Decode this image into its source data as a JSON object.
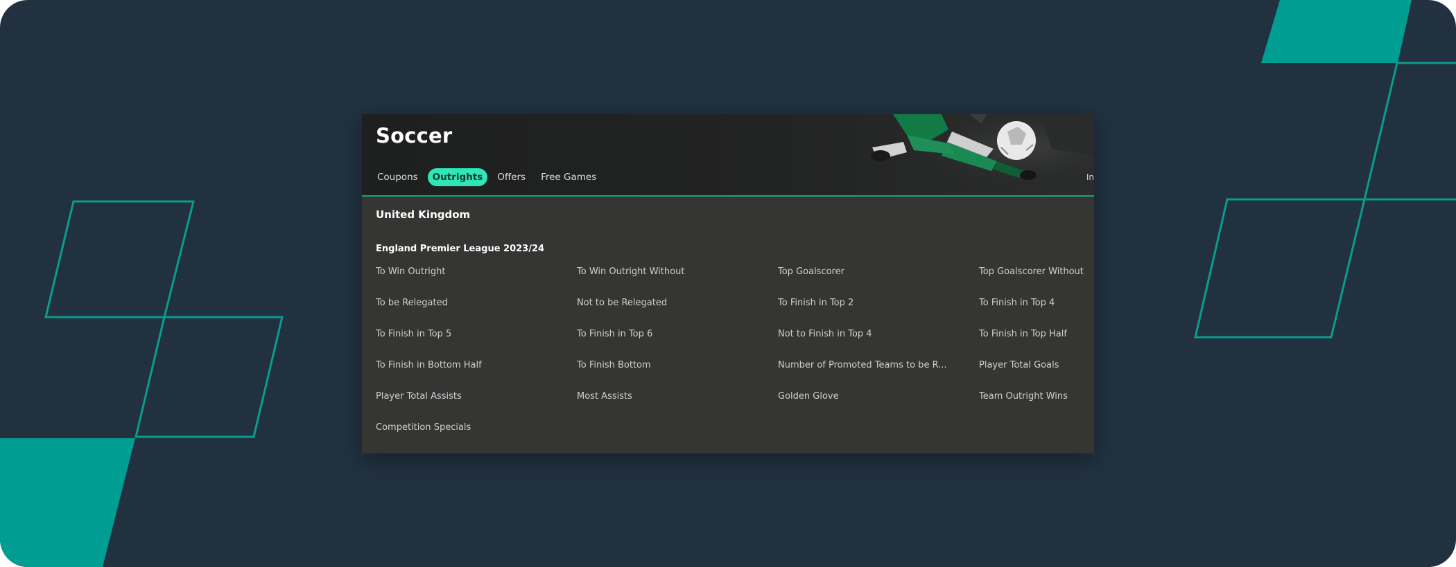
{
  "colors": {
    "background": "#213140",
    "accent": "#009e92",
    "card": "#353634",
    "active_tab": "#2ee6b6"
  },
  "sport": {
    "title": "Soccer",
    "tabs": [
      {
        "label": "Coupons",
        "active": false
      },
      {
        "label": "Outrights",
        "active": true
      },
      {
        "label": "Offers",
        "active": false
      },
      {
        "label": "Free Games",
        "active": false
      }
    ],
    "overflow_tab": "In"
  },
  "region": "United Kingdom",
  "league": "England Premier League 2023/24",
  "markets": [
    "To Win Outright",
    "To Win Outright Without",
    "Top Goalscorer",
    "Top Goalscorer Without",
    "To be Relegated",
    "Not to be Relegated",
    "To Finish in Top 2",
    "To Finish in Top 4",
    "To Finish in Top 5",
    "To Finish in Top 6",
    "Not to Finish in Top 4",
    "To Finish in Top Half",
    "To Finish in Bottom Half",
    "To Finish Bottom",
    "Number of Promoted Teams to be R...",
    "Player Total Goals",
    "Player Total Assists",
    "Most Assists",
    "Golden Glove",
    "Team Outright Wins",
    "Competition Specials"
  ],
  "icons": {
    "hero": "soccer-player-image"
  }
}
